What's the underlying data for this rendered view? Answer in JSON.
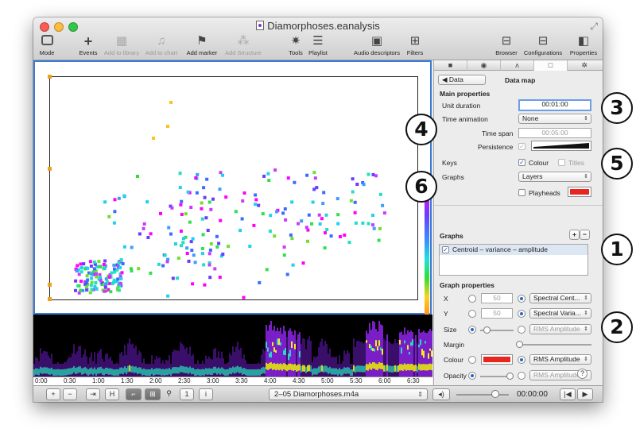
{
  "window": {
    "title": "Diamorphoses.eanalysis"
  },
  "toolbar": {
    "mode": "Mode",
    "events": "Events",
    "add_to_library": "Add to library",
    "add_to_chart": "Add to chart",
    "add_marker": "Add marker",
    "add_structure": "Add Structure",
    "tools": "Tools",
    "playlist": "Playlist",
    "audio_descriptors": "Audio descriptors",
    "filters": "Filters",
    "browser": "Browser",
    "configurations": "Configurations",
    "properties": "Properties"
  },
  "panel": {
    "back_label": "Data",
    "title": "Data map",
    "main_properties": "Main properties",
    "unit_duration_label": "Unit duration",
    "unit_duration_value": "00:01:00",
    "time_animation_label": "Time animation",
    "time_animation_value": "None",
    "time_span_label": "Time span",
    "time_span_value": "00:05:00",
    "persistence_label": "Persistence",
    "keys_label": "Keys",
    "keys_colour": "Colour",
    "keys_titles": "Titles",
    "graphs_label": "Graphs",
    "graphs_value": "Layers",
    "playheads_label": "Playheads",
    "graphs_header": "Graphs",
    "plus": "+",
    "minus": "−",
    "graph_item": "Centroid – variance – amplitude",
    "graph_properties": "Graph properties",
    "x_label": "X",
    "x_value": "50",
    "x_descriptor": "Spectral Cent...",
    "y_label": "Y",
    "y_value": "50",
    "y_descriptor": "Spectral Varia...",
    "size_label": "Size",
    "size_descriptor": "RMS Amplitude",
    "margin_label": "Margin",
    "colour_label": "Colour",
    "colour_descriptor": "RMS Amplitude",
    "opacity_label": "Opacity",
    "opacity_descriptor": "RMS Amplitude",
    "help": "?"
  },
  "callouts": [
    "1",
    "2",
    "3",
    "4",
    "5",
    "6"
  ],
  "timeline": {
    "ticks": [
      "0:00",
      "0:30",
      "1:00",
      "1:30",
      "2:00",
      "2:30",
      "3:00",
      "3:30",
      "4:00",
      "4:30",
      "5:00",
      "5:30",
      "6:00",
      "6:30"
    ]
  },
  "bottombar": {
    "plus": "+",
    "minus": "−",
    "h": "H",
    "one": "1",
    "info": "i",
    "file": "2–05 Diamorphoses.m4a",
    "time": "00:00:00"
  },
  "colors": {
    "accent": "#3b7ad6",
    "swatch_red": "#e8261f"
  }
}
